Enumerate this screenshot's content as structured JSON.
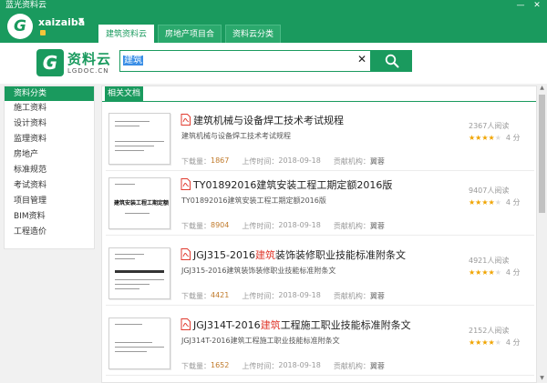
{
  "window": {
    "title": "蓝光资料云",
    "min_icon": "minimize-icon",
    "close_icon": "close-icon"
  },
  "header": {
    "username": "xaizaiba",
    "tabs": [
      {
        "label": "建筑资料云",
        "active": true
      },
      {
        "label": "房地产项目合",
        "active": false
      },
      {
        "label": "资料云分类",
        "active": false
      }
    ]
  },
  "brand": {
    "name": "资料云",
    "domain": "LGDOC.CN"
  },
  "search": {
    "value": "建筑",
    "clear_icon": "close-icon",
    "button_icon": "search-icon"
  },
  "sidebar": {
    "title": "资料分类",
    "items": [
      "施工资料",
      "设计资料",
      "监理资料",
      "房地产",
      "标准规范",
      "考试资料",
      "项目管理",
      "BIM资料",
      "工程造价"
    ]
  },
  "panel": {
    "tab_label": "相关文档"
  },
  "labels": {
    "downloads": "下载量：",
    "upload_time": "上传时间：",
    "contributor": "贡献机构："
  },
  "documents": [
    {
      "title_pre": "建筑机械与设备焊工技术考试规程",
      "title_hl": "",
      "title_post": "",
      "subtitle": "建筑机械与设备焊工技术考试规程",
      "downloads": "1867",
      "date": "2018-09-18",
      "author": "翼蓉",
      "views": "2367人阅读",
      "rating": 4,
      "score": "4 分"
    },
    {
      "title_pre": "TY01892016建筑安装工程工期定额2016版",
      "title_hl": "",
      "title_post": "",
      "subtitle": "TY01892016建筑安装工程工期定额2016版",
      "downloads": "8904",
      "date": "2018-09-18",
      "author": "翼蓉",
      "views": "9407人阅读",
      "rating": 4,
      "score": "4 分"
    },
    {
      "title_pre": "JGJ315-2016",
      "title_hl": "建筑",
      "title_post": "装饰装修职业技能标准附条文",
      "subtitle": "JGJ315-2016建筑装饰装修职业技能标准附条文",
      "downloads": "4421",
      "date": "2018-09-18",
      "author": "翼蓉",
      "views": "4921人阅读",
      "rating": 4,
      "score": "4 分"
    },
    {
      "title_pre": "JGJ314T-2016",
      "title_hl": "建筑",
      "title_post": "工程施工职业技能标准附条文",
      "subtitle": "JGJ314T-2016建筑工程施工职业技能标准附条文",
      "downloads": "1652",
      "date": "2018-09-18",
      "author": "翼蓉",
      "views": "2152人阅读",
      "rating": 4,
      "score": "4 分"
    }
  ],
  "thumbnails": {
    "doc2_heading": "建筑安装工程工期定额"
  },
  "colors": {
    "primary": "#1a9a5e",
    "highlight": "#e03b2f",
    "star": "#f0a400",
    "download": "#c07a2b"
  }
}
